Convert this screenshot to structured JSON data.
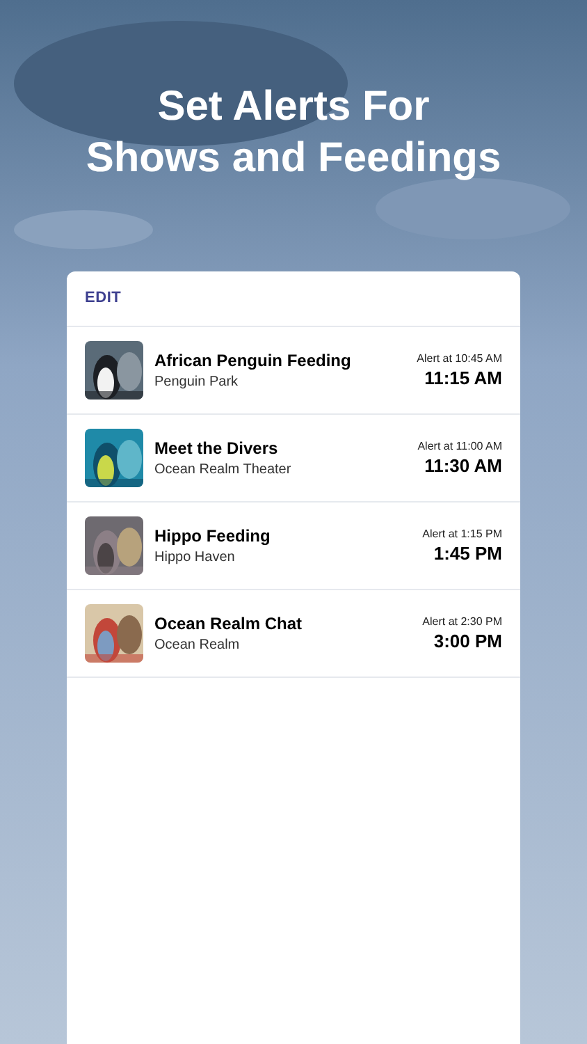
{
  "headline": "Set Alerts For Shows and Feedings",
  "edit_label": "EDIT",
  "alerts": [
    {
      "title": "African Penguin Feeding",
      "location": "Penguin Park",
      "alert": "Alert at 10:45 AM",
      "time": "11:15 AM"
    },
    {
      "title": "Meet the Divers",
      "location": "Ocean Realm Theater",
      "alert": "Alert at 11:00 AM",
      "time": "11:30 AM"
    },
    {
      "title": "Hippo Feeding",
      "location": "Hippo Haven",
      "alert": "Alert at 1:15 PM",
      "time": "1:45 PM"
    },
    {
      "title": "Ocean Realm Chat",
      "location": "Ocean Realm",
      "alert": "Alert at 2:30 PM",
      "time": "3:00 PM"
    }
  ]
}
